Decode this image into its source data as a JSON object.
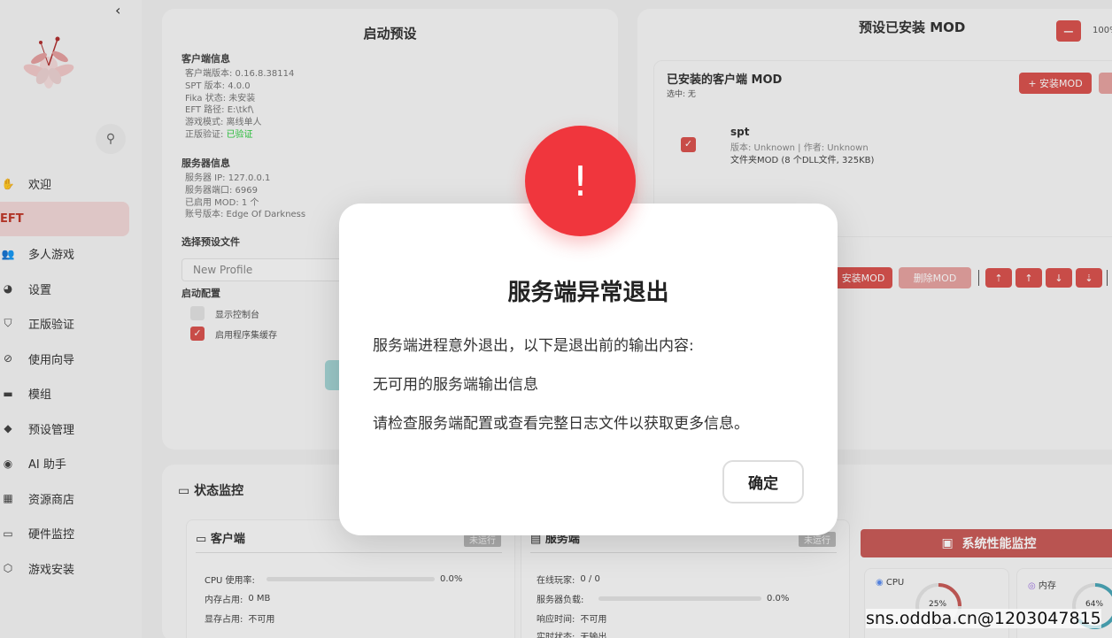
{
  "sidebar": {
    "collapse_icon": "chevron-left-icon",
    "items": [
      {
        "label": "欢迎",
        "icon": "hand-icon"
      },
      {
        "label": "EFT",
        "icon": ""
      },
      {
        "label": "多人游戏",
        "icon": "users-icon"
      },
      {
        "label": "设置",
        "icon": "palette-icon"
      },
      {
        "label": "正版验证",
        "icon": "shield-icon"
      },
      {
        "label": "使用向导",
        "icon": "compass-icon"
      },
      {
        "label": "模组",
        "icon": "box-icon"
      },
      {
        "label": "预设管理",
        "icon": "cards-icon"
      },
      {
        "label": "AI 助手",
        "icon": "robot-icon"
      },
      {
        "label": "资源商店",
        "icon": "store-icon"
      },
      {
        "label": "硬件监控",
        "icon": "monitor-icon"
      },
      {
        "label": "游戏安装",
        "icon": "box-open-icon"
      }
    ]
  },
  "launch": {
    "title": "启动预设",
    "client_title": "客户端信息",
    "client_lines": [
      "客户端版本: 0.16.8.38114",
      "SPT 版本: 4.0.0",
      "Fika 状态: 未安装",
      "EFT 路径: E:\\tkf\\",
      "游戏模式: 离线单人"
    ],
    "verify_label": "正版验证: ",
    "verify_value": "已验证",
    "server_title": "服务器信息",
    "server_lines": [
      "服务器 IP: 127.0.0.1",
      "服务器端口: 6969",
      "已启用 MOD: 1 个",
      "账号版本: Edge Of Darkness"
    ],
    "select_label": "选择预设文件",
    "select_value": "New Profile",
    "config_label": "启动配置",
    "opt_console": "显示控制台",
    "opt_cache": "启用程序集缓存"
  },
  "mods": {
    "title": "预设已安装 MOD",
    "zoom": "100%",
    "installed_title": "已安装的客户端 MOD",
    "selected": "选中: 无",
    "install_btn": "+ 安装MOD",
    "mod_name": "spt",
    "mod_meta": "版本: Unknown | 作者: Unknown",
    "mod_files": "文件夹MOD (8 个DLL文件, 325KB)",
    "install_btn2": "安装MOD",
    "delete_btn": "删除MOD"
  },
  "status": {
    "title": "状态监控",
    "client_title": "客户端",
    "client_badge": "未运行",
    "cpu_label": "CPU 使用率:",
    "cpu_value": "0.0%",
    "mem_label": "内存占用:",
    "mem_value": "0 MB",
    "vram_label": "显存占用:",
    "vram_value": "不可用",
    "server_title": "服务端",
    "server_badge": "未运行",
    "players_label": "在线玩家:",
    "players_value": "0 / 0",
    "load_label": "服务器负载:",
    "load_value": "0.0%",
    "resp_label": "响应时间:",
    "resp_value": "不可用",
    "rt_label": "实时状态:",
    "rt_value": "无输出",
    "perf_btn": "系统性能监控",
    "gauge_cpu_label": "CPU",
    "gauge_cpu_value": "25%",
    "gauge_mem_label": "内存",
    "gauge_mem_value": "64%"
  },
  "modal": {
    "icon": "!",
    "title": "服务端异常退出",
    "line1": "服务端进程意外退出，以下是退出前的输出内容:",
    "line2": "无可用的服务端输出信息",
    "line3": "请检查服务端配置或查看完整日志文件以获取更多信息。",
    "ok": "确定"
  },
  "watermark": "sns.oddba.cn@1203047815",
  "colors": {
    "accent": "#d9534f",
    "alert": "#f0363d",
    "ok": "#2ecc40"
  }
}
